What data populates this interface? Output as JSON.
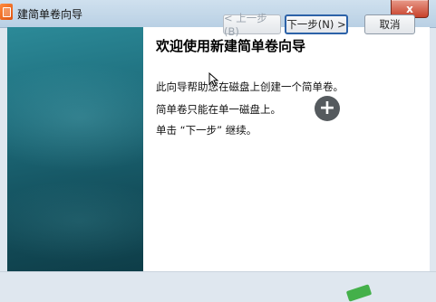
{
  "window": {
    "title": "建简单卷向导",
    "close_label": "x"
  },
  "wizard": {
    "heading": "欢迎使用新建简单卷向导",
    "lines": [
      "此向导帮助您在磁盘上创建一个简单卷。",
      "简单卷只能在单一磁盘上。",
      "单击 “下一步” 继续。"
    ]
  },
  "buttons": {
    "back": "< 上一步(B)",
    "next": "下一步(N) >",
    "cancel": "取消"
  },
  "overlay": {
    "plus_label": "+"
  },
  "colors": {
    "left_panel": "#1d6c7b",
    "titlebar": "#cfe0ee",
    "close_button": "#c7412a",
    "next_border": "#2c62a8",
    "marker": "#44b04a"
  }
}
